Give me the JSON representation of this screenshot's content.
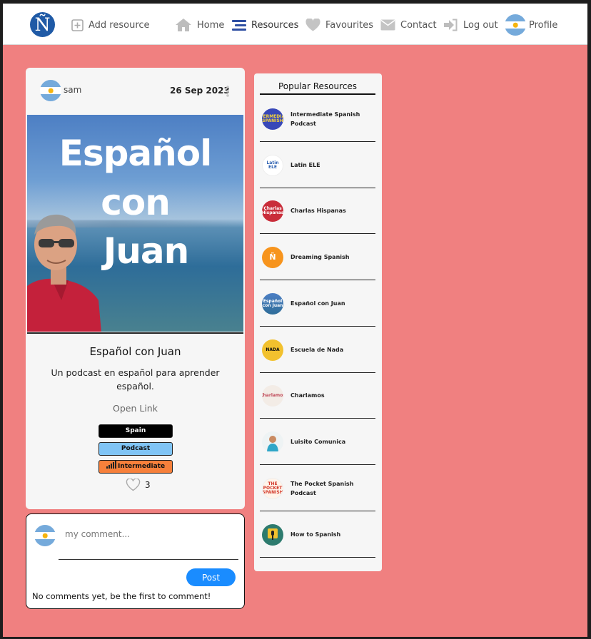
{
  "nav": {
    "logo": "Ñ",
    "add_resource": "Add resource",
    "home": "Home",
    "resources": "Resources",
    "favourites": "Favourites",
    "contact": "Contact",
    "logout": "Log out",
    "profile": "Profile"
  },
  "post": {
    "author": "sam",
    "date": "26 Sep 2023",
    "image_text": [
      "Español",
      "con",
      "Juan"
    ],
    "title": "Español con Juan",
    "description": "Un podcast en español para aprender español.",
    "open_link": "Open Link",
    "tags": {
      "country": "Spain",
      "type": "Podcast",
      "level": "Intermediate"
    },
    "likes": "3"
  },
  "comments": {
    "placeholder": "my comment...",
    "post_button": "Post",
    "empty_text": "No comments yet, be the first to comment!"
  },
  "popular": {
    "title": "Popular Resources",
    "items": [
      {
        "name": "Intermediate Spanish Podcast",
        "thumb": "INTERMEDIATE SPANISH"
      },
      {
        "name": "Latin ELE",
        "thumb": "Latin ELE"
      },
      {
        "name": "Charlas Hispanas",
        "thumb": "Charlas Hispanas"
      },
      {
        "name": "Dreaming Spanish",
        "thumb": "Ñ"
      },
      {
        "name": "Español con Juan",
        "thumb": "Español con Juan"
      },
      {
        "name": "Escuela de Nada",
        "thumb": "NADA"
      },
      {
        "name": "Charlamos",
        "thumb": "¿Charlamos?"
      },
      {
        "name": "Luisito Comunica",
        "thumb": ""
      },
      {
        "name": "The Pocket Spanish Podcast",
        "thumb": "THE POCKET SPANISH"
      },
      {
        "name": "How to Spanish",
        "thumb": ""
      }
    ]
  },
  "colors": {
    "page_bg": "#f08080",
    "card_bg": "#f6f6f6",
    "logo_bg": "#1f5aa6",
    "resources_icon": "#2f4fa3",
    "post_button": "#1a8cff",
    "tag_spain": "#000000",
    "tag_podcast": "#80c4f5",
    "tag_level": "#f7803b"
  }
}
